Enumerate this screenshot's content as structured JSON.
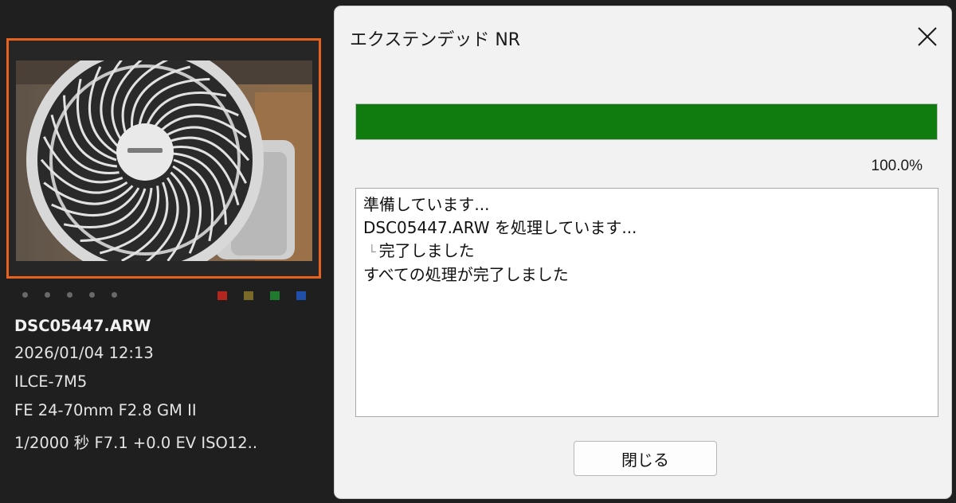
{
  "thumbnail": {
    "file_name": "DSC05447.ARW",
    "datetime": "2026/01/04 12:13",
    "camera": "ILCE-7M5",
    "lens": "FE 24-70mm F2.8 GM II",
    "exposure": "1/2000 秒 F7.1 +0.0 EV ISO12..",
    "rating_dot_count": 5,
    "color_labels": [
      "#b3261e",
      "#7a6a2a",
      "#1f7a2e",
      "#1f4fa8"
    ],
    "selection_color": "#e8621f"
  },
  "dialog": {
    "title": "エクステンデッド NR",
    "progress": 1.0,
    "progress_label": "100.0%",
    "progress_color": "#107c10",
    "log": {
      "line1": "準備しています...",
      "line2": "DSC05447.ARW を処理しています...",
      "line3": "完了しました",
      "line4": "すべての処理が完了しました"
    },
    "close_button_label": "閉じる"
  }
}
